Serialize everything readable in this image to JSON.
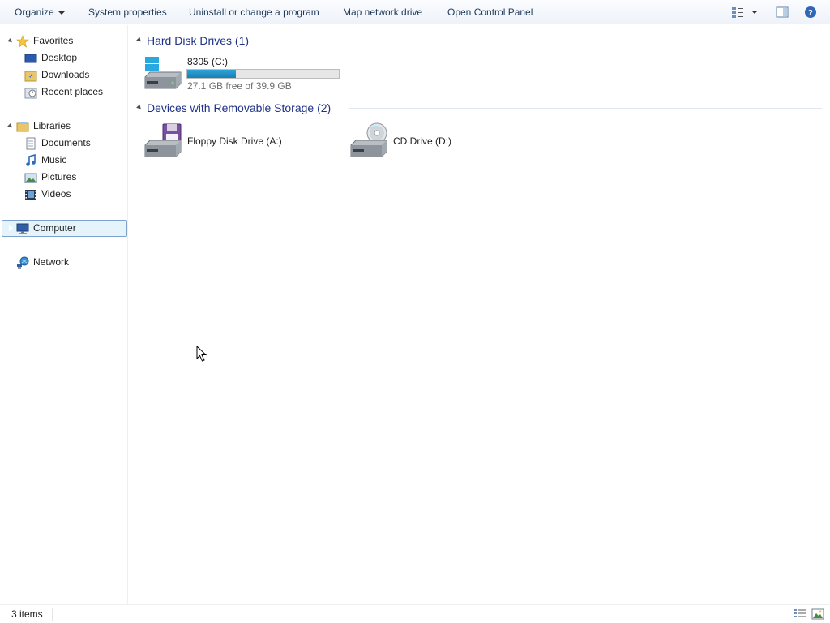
{
  "toolbar": {
    "organize": "Organize",
    "system_properties": "System properties",
    "uninstall": "Uninstall or change a program",
    "map_drive": "Map network drive",
    "control_panel": "Open Control Panel",
    "icons": [
      "change-view-icon",
      "preview-pane-icon",
      "help-icon"
    ]
  },
  "nav": {
    "favorites": {
      "label": "Favorites",
      "items": [
        "Desktop",
        "Downloads",
        "Recent places"
      ]
    },
    "libraries": {
      "label": "Libraries",
      "items": [
        "Documents",
        "Music",
        "Pictures",
        "Videos"
      ]
    },
    "computer": "Computer",
    "network": "Network"
  },
  "groups": {
    "hdd": {
      "title": "Hard Disk Drives (1)",
      "drive": {
        "name": "8305 (C:)",
        "free_text": "27.1 GB free of 39.9 GB",
        "used_fraction": 0.32
      }
    },
    "removable": {
      "title": "Devices with Removable Storage (2)",
      "drives": [
        "Floppy Disk Drive (A:)",
        "CD Drive (D:)"
      ]
    }
  },
  "status": {
    "items": "3 items"
  },
  "colors": {
    "group_title": "#1e3287",
    "selection_bg": "#e5f3fb",
    "selection_border": "#7da2ce",
    "usage_bar": "#2ea4d8"
  }
}
